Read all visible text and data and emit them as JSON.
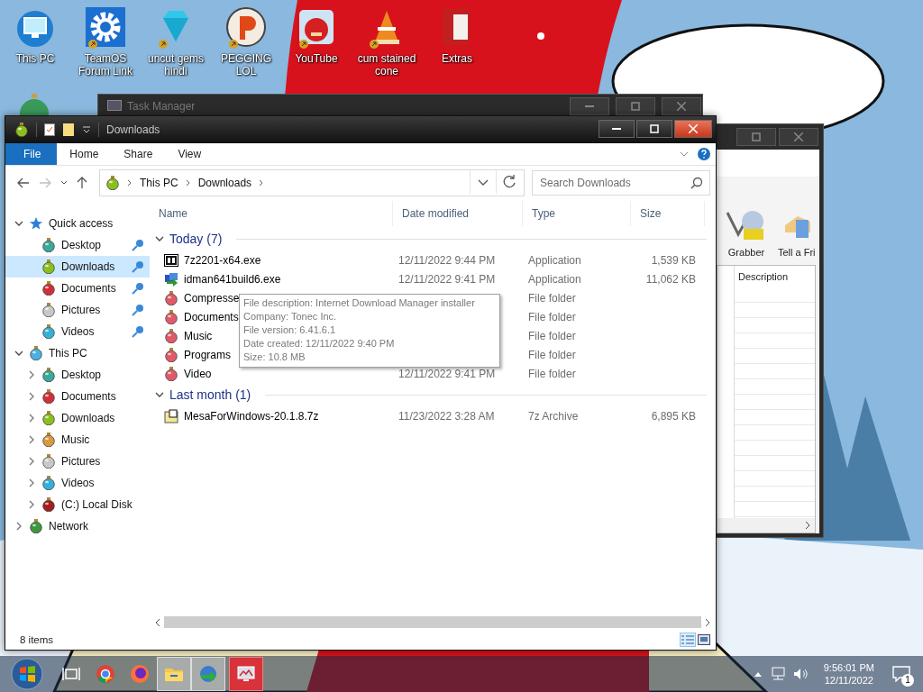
{
  "desktop_icons": [
    {
      "label": "This PC",
      "kind": "monitor",
      "shortcut": false
    },
    {
      "label": "TeamOS Forum Link",
      "kind": "gear",
      "shortcut": true
    },
    {
      "label": "uncut gems hindi",
      "kind": "gem",
      "shortcut": true
    },
    {
      "label": "PEGGING LOL",
      "kind": "badge",
      "shortcut": true
    },
    {
      "label": "YouTube",
      "kind": "bird",
      "shortcut": true
    },
    {
      "label": "cum stained cone",
      "kind": "cone",
      "shortcut": true
    },
    {
      "label": "Extras",
      "kind": "book",
      "shortcut": false
    }
  ],
  "task_manager": {
    "title": "Task Manager"
  },
  "idm_window": {
    "toolbar": [
      {
        "label": "Grabber"
      },
      {
        "label": "Tell a Fri"
      }
    ],
    "column": "Description"
  },
  "explorer": {
    "title": "Downloads",
    "ribbon_tabs": [
      {
        "label": "File",
        "selected": true
      },
      {
        "label": "Home",
        "selected": false
      },
      {
        "label": "Share",
        "selected": false
      },
      {
        "label": "View",
        "selected": false
      }
    ],
    "address": [
      "This PC",
      "Downloads"
    ],
    "search": {
      "placeholder": "Search Downloads"
    },
    "nav": [
      {
        "label": "Quick access",
        "kind": "star",
        "expanded": true,
        "children": [
          {
            "label": "Desktop",
            "kind": "teal",
            "pinned": true,
            "selected": false
          },
          {
            "label": "Downloads",
            "kind": "green",
            "pinned": true,
            "selected": true
          },
          {
            "label": "Documents",
            "kind": "red",
            "pinned": true,
            "selected": false
          },
          {
            "label": "Pictures",
            "kind": "grey",
            "pinned": true,
            "selected": false
          },
          {
            "label": "Videos",
            "kind": "cyan",
            "pinned": true,
            "selected": false
          }
        ]
      },
      {
        "label": "This PC",
        "kind": "pc",
        "expanded": true,
        "children": [
          {
            "label": "Desktop",
            "kind": "teal",
            "expanded": false
          },
          {
            "label": "Documents",
            "kind": "red",
            "expanded": false
          },
          {
            "label": "Downloads",
            "kind": "green",
            "expanded": false
          },
          {
            "label": "Music",
            "kind": "orange",
            "expanded": false
          },
          {
            "label": "Pictures",
            "kind": "grey",
            "expanded": false
          },
          {
            "label": "Videos",
            "kind": "cyan",
            "expanded": false
          },
          {
            "label": "(C:) Local Disk",
            "kind": "disk",
            "expanded": false
          }
        ]
      },
      {
        "label": "Network",
        "kind": "net",
        "expanded": false
      }
    ],
    "columns": [
      "Name",
      "Date modified",
      "Type",
      "Size"
    ],
    "groups": [
      {
        "label": "Today (7)",
        "expanded": true,
        "files": [
          {
            "name": "7z2201-x64.exe",
            "kind": "sevenzip",
            "date": "12/11/2022 9:44 PM",
            "type": "Application",
            "size": "1,539 KB"
          },
          {
            "name": "idman641build6.exe",
            "kind": "installer",
            "date": "12/11/2022 9:41 PM",
            "type": "Application",
            "size": "11,062 KB"
          },
          {
            "name": "Compresse",
            "kind": "folder",
            "type": "File folder"
          },
          {
            "name": "Documents",
            "kind": "folder",
            "type": "File folder"
          },
          {
            "name": "Music",
            "kind": "folder",
            "type": "File folder"
          },
          {
            "name": "Programs",
            "kind": "folder",
            "type": "File folder"
          },
          {
            "name": "Video",
            "kind": "folder",
            "date": "12/11/2022 9:41 PM",
            "type": "File folder"
          }
        ]
      },
      {
        "label": "Last month (1)",
        "expanded": true,
        "files": [
          {
            "name": "MesaForWindows-20.1.8.7z",
            "kind": "archive",
            "date": "11/23/2022 3:28 AM",
            "type": "7z Archive",
            "size": "6,895 KB"
          }
        ]
      }
    ],
    "tooltip": [
      "File description: Internet Download Manager installer",
      "Company: Tonec Inc.",
      "File version: 6.41.6.1",
      "Date created: 12/11/2022 9:40 PM",
      "Size: 10.8 MB"
    ],
    "status": "8 items"
  },
  "taskbar": {
    "apps": [
      {
        "kind": "taskview",
        "active": false
      },
      {
        "kind": "chrome",
        "active": false
      },
      {
        "kind": "firefox",
        "active": false
      },
      {
        "kind": "folder",
        "active": true
      },
      {
        "kind": "idm",
        "active": true
      },
      {
        "kind": "monitor",
        "active": false,
        "highlight": true
      }
    ],
    "time": "9:56:01 PM",
    "date": "12/11/2022",
    "notifications": "1"
  }
}
